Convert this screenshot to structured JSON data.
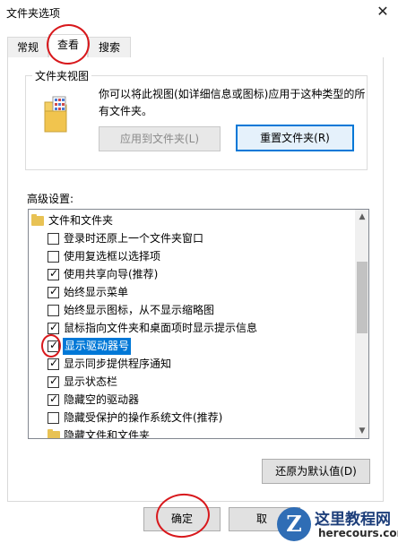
{
  "window": {
    "title": "文件夹选项",
    "close_icon": "close-icon"
  },
  "tabs": [
    {
      "label": "常规",
      "active": false
    },
    {
      "label": "查看",
      "active": true
    },
    {
      "label": "搜索",
      "active": false
    }
  ],
  "folder_views": {
    "group_label": "文件夹视图",
    "icon": "folder-grid-icon",
    "description_line1": "你可以将此视图(如详细信息或图标)应用于这种类型的所",
    "description_line2": "有文件夹。",
    "apply_button": "应用到文件夹(L)",
    "reset_button": "重置文件夹(R)"
  },
  "advanced": {
    "label": "高级设置:",
    "items": [
      {
        "type": "folder",
        "label": "文件和文件夹"
      },
      {
        "type": "checkbox",
        "label": "登录时还原上一个文件夹窗口",
        "checked": false
      },
      {
        "type": "checkbox",
        "label": "使用复选框以选择项",
        "checked": false
      },
      {
        "type": "checkbox",
        "label": "使用共享向导(推荐)",
        "checked": true
      },
      {
        "type": "checkbox",
        "label": "始终显示菜单",
        "checked": true
      },
      {
        "type": "checkbox",
        "label": "始终显示图标，从不显示缩略图",
        "checked": false
      },
      {
        "type": "checkbox",
        "label": "鼠标指向文件夹和桌面项时显示提示信息",
        "checked": true
      },
      {
        "type": "checkbox",
        "label": "显示驱动器号",
        "checked": true,
        "selected": true
      },
      {
        "type": "checkbox",
        "label": "显示同步提供程序通知",
        "checked": true
      },
      {
        "type": "checkbox",
        "label": "显示状态栏",
        "checked": true
      },
      {
        "type": "checkbox",
        "label": "隐藏空的驱动器",
        "checked": true
      },
      {
        "type": "checkbox",
        "label": "隐藏受保护的操作系统文件(推荐)",
        "checked": false
      },
      {
        "type": "folder",
        "label": "隐藏文件和文件夹"
      }
    ],
    "restore_button": "还原为默认值(D)"
  },
  "footer": {
    "ok_button": "确定",
    "cancel_button": "取"
  },
  "watermark": {
    "logo_letter": "Z",
    "site_name": "这里教程网",
    "site_url": "herecours.com"
  },
  "colors": {
    "selection": "#0078d7",
    "annotation": "#d8181c"
  }
}
